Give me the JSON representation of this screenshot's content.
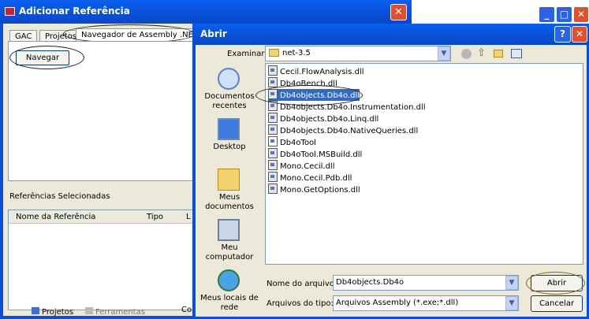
{
  "back_window": {
    "title": "Adicionar Referência",
    "close_glyph": "✕",
    "tabs": [
      "GAC",
      "Projetos",
      "Navegador de Assembly .NET"
    ],
    "navegar_button": "Navegar",
    "selected_refs_label": "Referências Selecionadas",
    "columns": [
      "Nome da Referência",
      "Tipo",
      "L"
    ],
    "bottom_tabs": [
      "Projetos",
      "Ferramentas"
    ],
    "bottom_cut": "Co"
  },
  "dialog": {
    "title": "Abrir",
    "help_glyph": "?",
    "close_glyph": "✕",
    "minimize_glyph": "_",
    "maximize_glyph": "□",
    "look_in_label": "Examinar:",
    "look_in_value": "net-3.5",
    "places": [
      {
        "icon": "recent-documents-icon",
        "label": "Documentos recentes"
      },
      {
        "icon": "desktop-icon",
        "label": "Desktop"
      },
      {
        "icon": "my-documents-icon",
        "label": "Meus documentos"
      },
      {
        "icon": "my-computer-icon",
        "label": "Meu computador"
      },
      {
        "icon": "network-places-icon",
        "label": "Meus locais de rede"
      }
    ],
    "files": [
      "Cecil.FlowAnalysis.dll",
      "Db4oBench.dll",
      "Db4objects.Db4o.dll",
      "Db4objects.Db4o.Instrumentation.dll",
      "Db4objects.Db4o.Linq.dll",
      "Db4objects.Db4o.NativeQueries.dll",
      "Db4oTool",
      "Db4oTool.MSBuild.dll",
      "Mono.Cecil.dll",
      "Mono.Cecil.Pdb.dll",
      "Mono.GetOptions.dll"
    ],
    "selected_file": "Db4objects.Db4o.dll",
    "file_name_label": "Nome do arquivo:",
    "file_name_value": "Db4objects.Db4o",
    "file_type_label": "Arquivos do tipo:",
    "file_type_value": "Arquivos Assembly (*.exe;*.dll)",
    "open_button": "Abrir",
    "cancel_button": "Cancelar"
  },
  "colors": {
    "title_blue": "#0a4fd6",
    "face": "#ece9d8",
    "selection": "#316ac5"
  }
}
